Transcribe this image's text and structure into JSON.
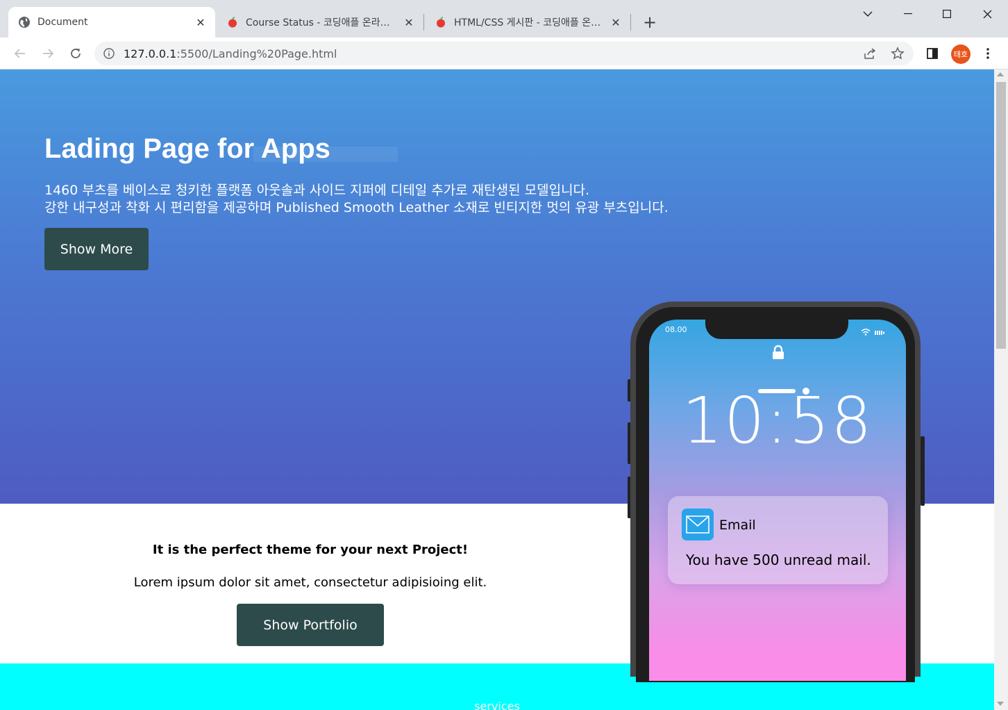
{
  "browser": {
    "tabs": [
      {
        "title": "Document",
        "favicon": "globe-icon",
        "active": true
      },
      {
        "title": "Course Status - 코딩애플 온라인 강좌",
        "favicon": "apple-icon",
        "active": false
      },
      {
        "title": "HTML/CSS 게시판 - 코딩애플 온라인",
        "favicon": "apple-icon",
        "active": false
      }
    ],
    "new_tab_label": "+",
    "url_host": "127.0.0.1",
    "url_rest": ":5500/Landing%20Page.html",
    "profile_label": "태호"
  },
  "hero": {
    "title": "Lading Page for Apps",
    "desc_line1": "1460 부츠를 베이스로 청키한 플랫폼 아웃솔과 사이드 지퍼에 디테일 추가로 재탄생된 모델입니다.",
    "desc_line2": "강한 내구성과 착화 시 편리함을 제공하며 Published Smooth Leather 소재로 빈티지한 멋의 유광 부츠입니다.",
    "button_label": "Show More"
  },
  "info": {
    "lead": "It is the perfect theme for your next Project!",
    "sub": "Lorem ipsum dolor sit amet, consectetur adipisioing elit.",
    "button_label": "Show Portfolio"
  },
  "phone": {
    "status_time": "08.00",
    "clock": "10:58",
    "notification_app": "Email",
    "notification_message": "You have 500 unread mail."
  },
  "services": {
    "label": "services"
  },
  "colors": {
    "hero_top": "#4a9adf",
    "hero_bottom": "#4e5cc2",
    "button": "#2d4b4b",
    "services_bg": "#00ffff",
    "profile": "#e8541b"
  }
}
